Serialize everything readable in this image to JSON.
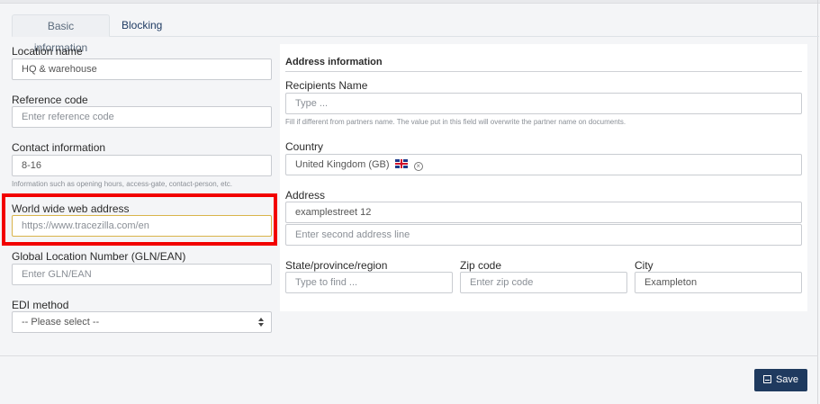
{
  "tabs": {
    "basic": "Basic information",
    "blocking": "Blocking"
  },
  "left": {
    "location_name": {
      "label": "Location name",
      "value": "HQ & warehouse"
    },
    "reference_code": {
      "label": "Reference code",
      "placeholder": "Enter reference code"
    },
    "contact_info": {
      "label": "Contact information",
      "value": "8-16",
      "help": "Information such as opening hours, access-gate, contact-person, etc."
    },
    "www": {
      "label": "World wide web address",
      "placeholder": "https://www.tracezilla.com/en"
    },
    "gln": {
      "label": "Global Location Number (GLN/EAN)",
      "placeholder": "Enter GLN/EAN"
    },
    "edi": {
      "label": "EDI method",
      "selected": "-- Please select --"
    }
  },
  "address": {
    "section_title": "Address information",
    "recipients": {
      "label": "Recipients Name",
      "placeholder": "Type ...",
      "help": "Fill if different from partners name. The value put in this field will overwrite the partner name on documents."
    },
    "country": {
      "label": "Country",
      "value": "United Kingdom (GB)"
    },
    "address": {
      "label": "Address",
      "line1": "examplestreet 12",
      "line2_placeholder": "Enter second address line"
    },
    "state": {
      "label": "State/province/region",
      "placeholder": "Type to find ..."
    },
    "zip": {
      "label": "Zip code",
      "placeholder": "Enter zip code"
    },
    "city": {
      "label": "City",
      "value": "Exampleton"
    }
  },
  "footer": {
    "save": "Save"
  },
  "colors": {
    "highlight": "#f20000",
    "primary": "#1f3a5f",
    "focus_border": "#d9b44a"
  }
}
